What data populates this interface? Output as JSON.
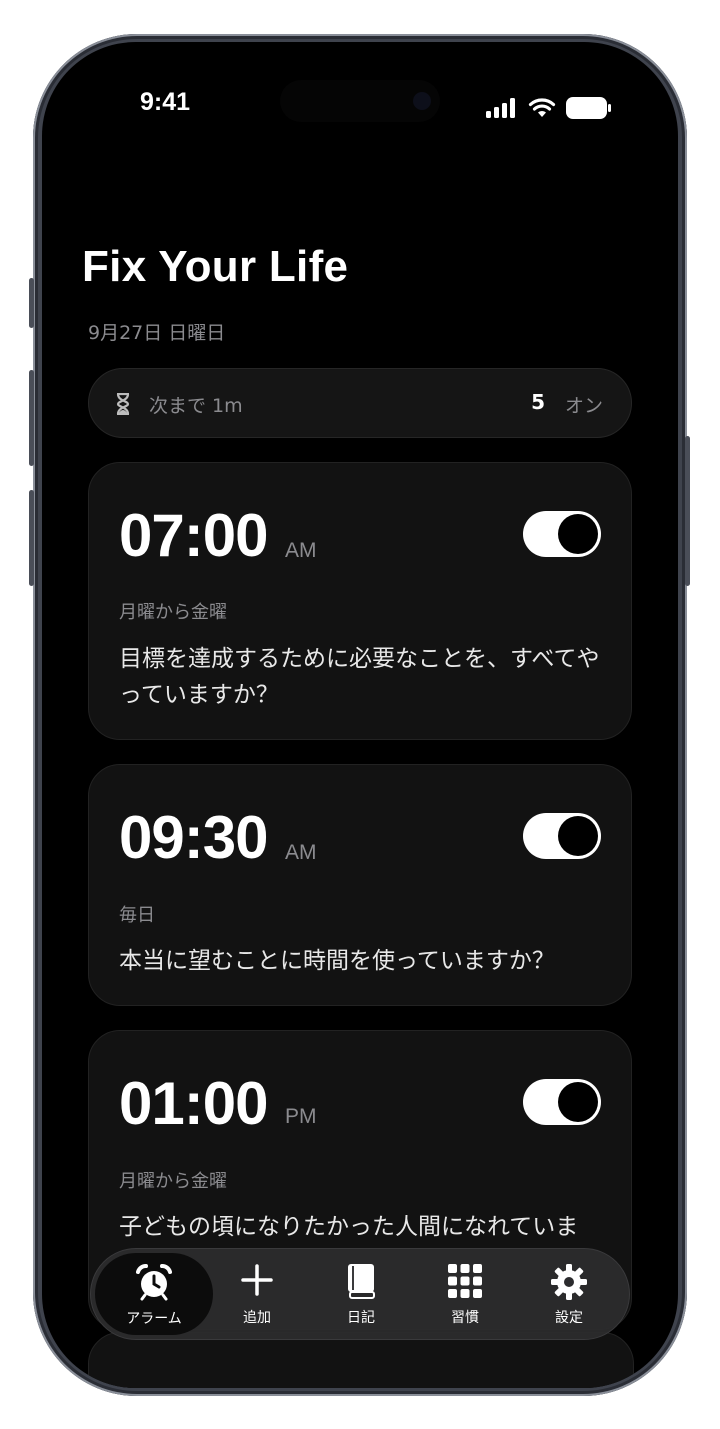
{
  "status_bar": {
    "time": "9:41"
  },
  "header": {
    "title": "Fix Your Life",
    "date": "9月27日 日曜日"
  },
  "summary": {
    "next_label": "次まで 1m",
    "active_count": "5",
    "active_label": "オン"
  },
  "alarms": [
    {
      "time": "07:00",
      "period": "AM",
      "days": "月曜から金曜",
      "message": "目標を達成するために必要なことを、すべてやっていますか？",
      "enabled": true
    },
    {
      "time": "09:30",
      "period": "AM",
      "days": "毎日",
      "message": "本当に望むことに時間を使っていますか？",
      "enabled": true
    },
    {
      "time": "01:00",
      "period": "PM",
      "days": "月曜から金曜",
      "message": "子どもの頃になりたかった人間になれていま",
      "enabled": true
    }
  ],
  "tabbar": {
    "items": [
      {
        "label": "アラーム",
        "icon": "alarm-clock-icon",
        "active": true
      },
      {
        "label": "追加",
        "icon": "plus-icon",
        "active": false
      },
      {
        "label": "日記",
        "icon": "book-icon",
        "active": false
      },
      {
        "label": "習慣",
        "icon": "grid-icon",
        "active": false
      },
      {
        "label": "設定",
        "icon": "gear-icon",
        "active": false
      }
    ]
  },
  "colors": {
    "background": "#000000",
    "card": "#121212",
    "muted_text": "#8b8b8f",
    "toggle_on": "#ffffff"
  }
}
